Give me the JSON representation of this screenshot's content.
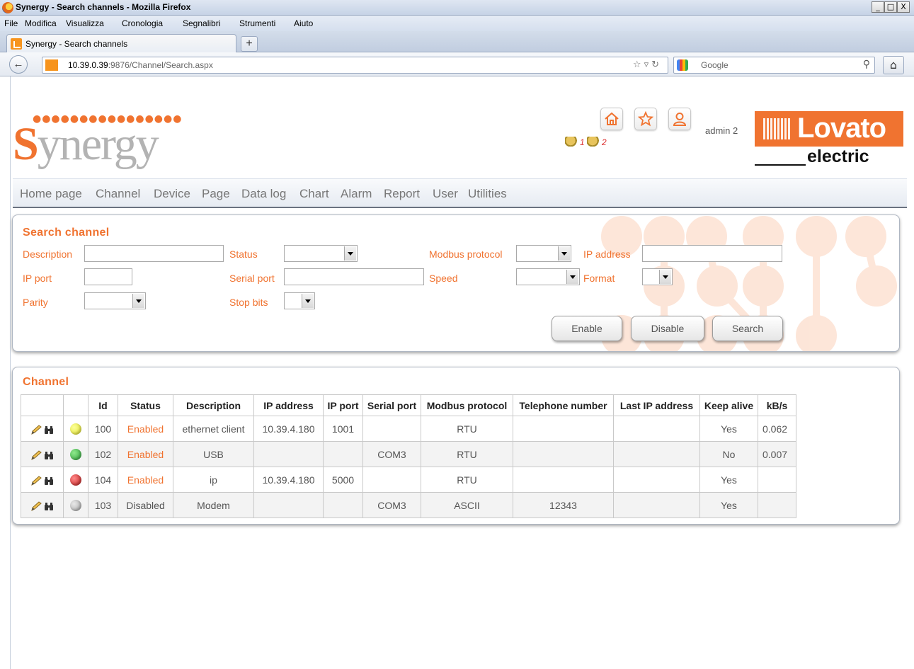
{
  "window": {
    "title": "Synergy - Search channels - Mozilla Firefox",
    "buttons": [
      "_",
      "□",
      "X"
    ]
  },
  "menubar": [
    "File",
    "Modifica",
    "Visualizza",
    "Cronologia",
    "Segnalibri",
    "Strumenti",
    "Aiuto"
  ],
  "tab": {
    "label": "Synergy - Search channels",
    "new_tab": "+"
  },
  "urlbar": {
    "host": "10.39.0.39",
    "path": ":9876/Channel/Search.aspx",
    "search_placeholder": "Google"
  },
  "header": {
    "brand": "ynergy",
    "brand_initial": "S",
    "user": "admin 2",
    "notifications": [
      "1",
      "2"
    ],
    "lovato_word": "Lovato",
    "lovato_sub": "electric"
  },
  "mainnav": [
    "Home page",
    "Channel",
    "Device",
    "Page",
    "Data log",
    "Chart",
    "Alarm",
    "Report",
    "User",
    "Utilities"
  ],
  "search": {
    "title": "Search channel",
    "labels": {
      "description": "Description",
      "ip_port": "IP port",
      "parity": "Parity",
      "status": "Status",
      "serial_port": "Serial port",
      "stop_bits": "Stop bits",
      "modbus_protocol": "Modbus protocol",
      "speed": "Speed",
      "ip_address": "IP address",
      "format": "Format"
    },
    "buttons": {
      "enable": "Enable",
      "disable": "Disable",
      "search": "Search"
    }
  },
  "channels": {
    "title": "Channel",
    "columns": [
      "",
      "",
      "Id",
      "Status",
      "Description",
      "IP address",
      "IP port",
      "Serial port",
      "Modbus protocol",
      "Telephone number",
      "Last IP address",
      "Keep alive",
      "kB/s"
    ],
    "rows": [
      {
        "led": "yellow",
        "id": "100",
        "status": "Enabled",
        "description": "ethernet client",
        "ip": "10.39.4.180",
        "port": "1001",
        "serial": "",
        "modbus": "RTU",
        "phone": "",
        "last_ip": "",
        "keep_alive": "Yes",
        "kbs": "0.062"
      },
      {
        "led": "green",
        "id": "102",
        "status": "Enabled",
        "description": "USB",
        "ip": "",
        "port": "",
        "serial": "COM3",
        "modbus": "RTU",
        "phone": "",
        "last_ip": "",
        "keep_alive": "No",
        "kbs": "0.007"
      },
      {
        "led": "red",
        "id": "104",
        "status": "Enabled",
        "description": "ip",
        "ip": "10.39.4.180",
        "port": "5000",
        "serial": "",
        "modbus": "RTU",
        "phone": "",
        "last_ip": "",
        "keep_alive": "Yes",
        "kbs": ""
      },
      {
        "led": "grey",
        "id": "103",
        "status": "Disabled",
        "description": "Modem",
        "ip": "",
        "port": "",
        "serial": "COM3",
        "modbus": "ASCII",
        "phone": "12343",
        "last_ip": "",
        "keep_alive": "Yes",
        "kbs": ""
      }
    ]
  },
  "colors": {
    "accent": "#f07330",
    "nav_text": "#777777"
  }
}
